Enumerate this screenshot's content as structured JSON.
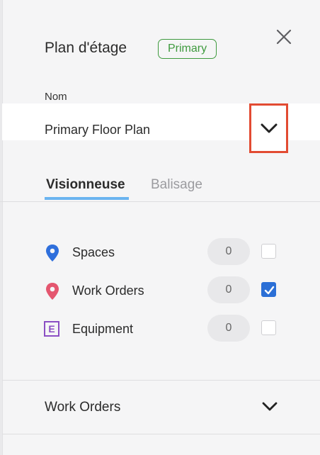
{
  "header": {
    "title": "Plan d'étage",
    "badge": "Primary",
    "close_icon": "close-icon"
  },
  "floor_select": {
    "label": "Nom",
    "value": "Primary Floor Plan",
    "chevron_icon": "chevron-down-icon"
  },
  "tabs": [
    {
      "label": "Visionneuse",
      "active": true
    },
    {
      "label": "Balisage",
      "active": false
    }
  ],
  "layers": [
    {
      "label": "Spaces",
      "count": "0",
      "checked": false,
      "icon": "map-pin-icon",
      "color": "#2f6fdc"
    },
    {
      "label": "Work Orders",
      "count": "0",
      "checked": true,
      "icon": "map-pin-icon",
      "color": "#e4566f"
    },
    {
      "label": "Equipment",
      "count": "0",
      "checked": false,
      "icon": "equipment-icon",
      "icon_letter": "E",
      "color": "#8b4fc4"
    }
  ],
  "section": {
    "label": "Work Orders",
    "chevron_icon": "chevron-down-icon"
  },
  "colors": {
    "accent": "#2b6fd6",
    "tab_underline": "#6ab4f0",
    "badge_green": "#3e9a3e",
    "highlight_border": "#e24b32"
  }
}
